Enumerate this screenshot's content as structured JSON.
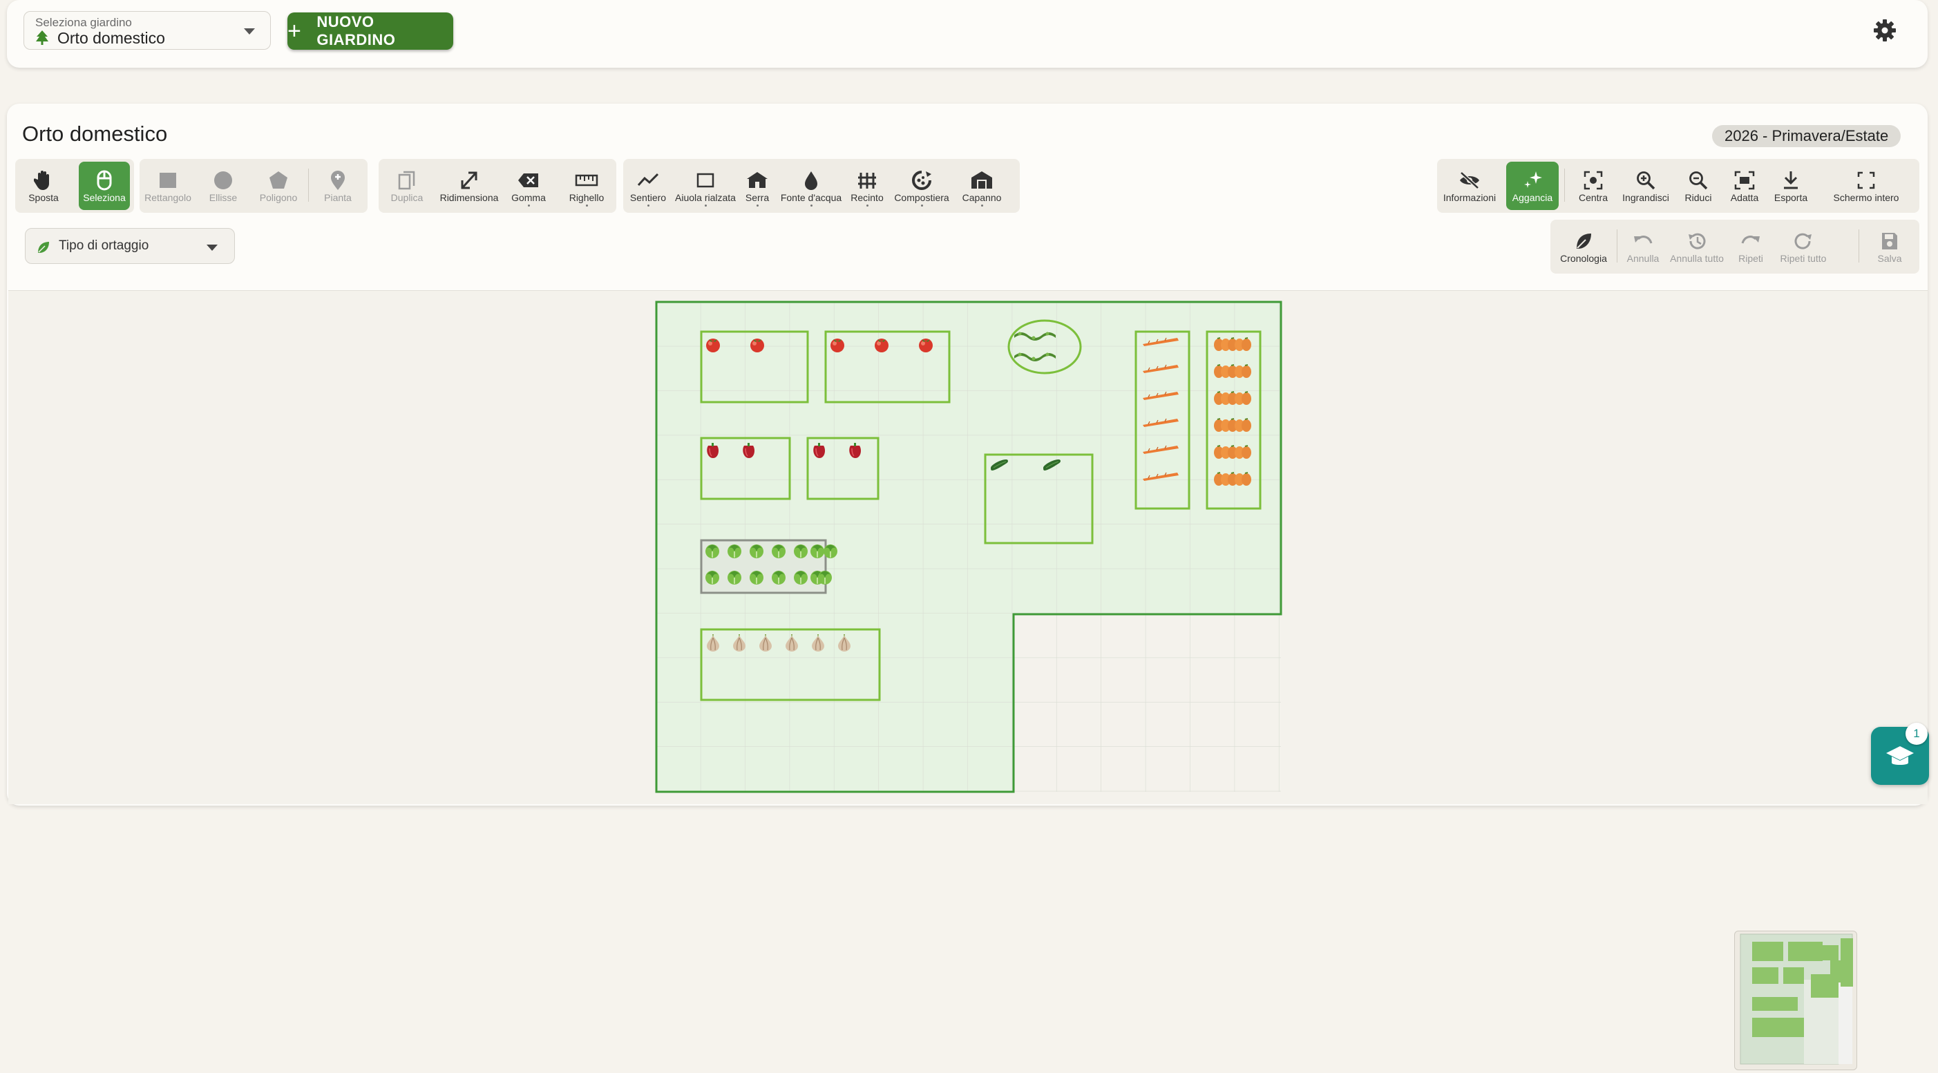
{
  "topbar": {
    "selector_label": "Seleziona giardino",
    "selector_value": "Orto domestico",
    "new_garden": "NUOVO GIARDINO"
  },
  "garden": {
    "title": "Orto domestico",
    "season": "2026 - Primavera/Estate"
  },
  "tools": {
    "nav": [
      "Sposta",
      "Seleziona"
    ],
    "shapes": [
      "Rettangolo",
      "Ellisse",
      "Poligono",
      "Pianta"
    ],
    "edit": [
      "Duplica",
      "Ridimensiona",
      "Gomma",
      "Righello"
    ],
    "structures": [
      "Sentiero",
      "Aiuola rialzata",
      "Serra",
      "Fonte d'acqua",
      "Recinto",
      "Compostiera",
      "Capanno"
    ],
    "view": [
      "Informazioni",
      "Aggancia",
      "Centra",
      "Ingrandisci",
      "Riduci",
      "Adatta",
      "Esporta",
      "Schermo intero"
    ],
    "history": [
      "Cronologia",
      "Annulla",
      "Annulla tutto",
      "Ripeti",
      "Ripeti tutto",
      "Salva"
    ]
  },
  "veg_filter": {
    "placeholder": "Tipo di ortaggio"
  },
  "help": {
    "badge": "1"
  },
  "colors": {
    "primary": "#3f7d2a",
    "active_tool": "#4d9a45",
    "garden_fill": "#e6f3e2",
    "garden_border": "#3f9a37",
    "bed_border": "#7cbf3b",
    "help": "#16918a"
  },
  "icons": {
    "settings": "gear-icon",
    "plus": "plus-icon",
    "tree": "tree-icon",
    "help": "graduation-cap-icon"
  }
}
